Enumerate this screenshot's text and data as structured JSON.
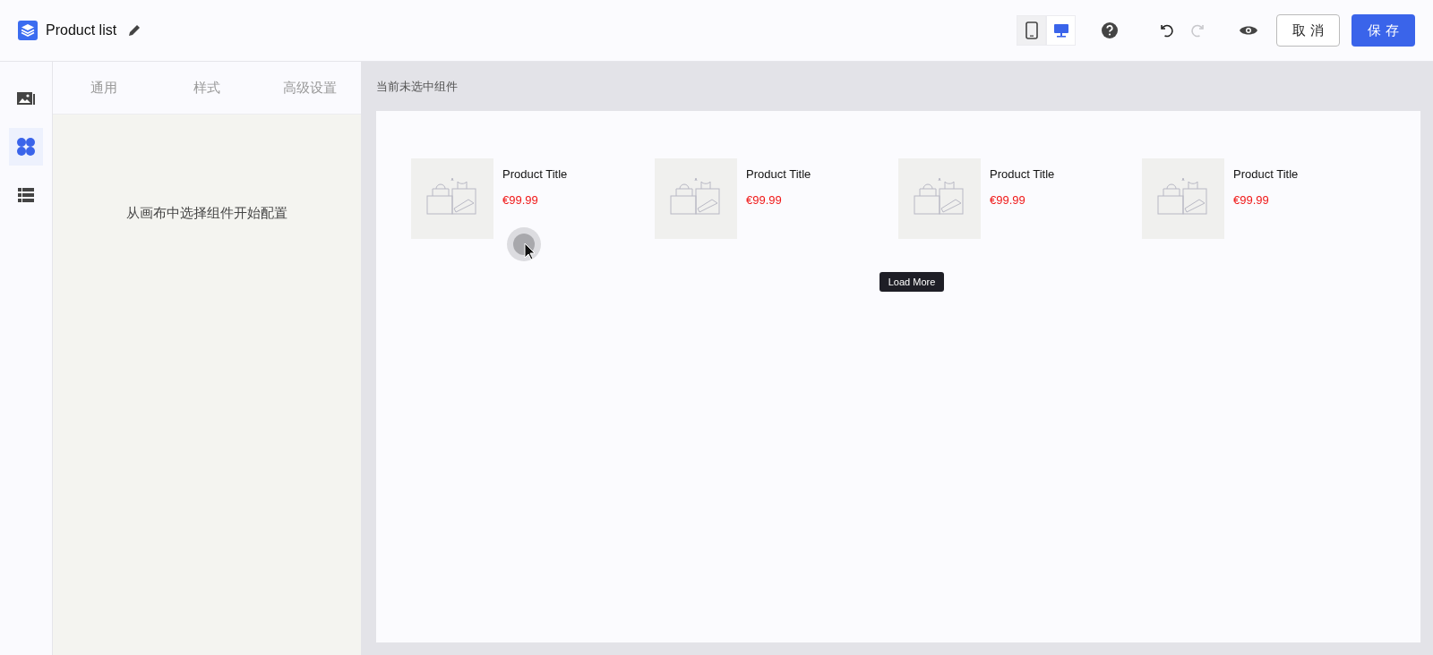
{
  "header": {
    "title": "Product list",
    "devices": [
      {
        "kind": "mobile",
        "selected": false
      },
      {
        "kind": "desktop",
        "selected": true
      }
    ],
    "history": [
      {
        "kind": "undo",
        "disabled": false
      },
      {
        "kind": "redo",
        "disabled": true
      }
    ],
    "cancel_label": "取 消",
    "save_label": "保 存"
  },
  "sidebar": {
    "items": [
      {
        "kind": "media",
        "selected": false
      },
      {
        "kind": "components",
        "selected": true
      },
      {
        "kind": "layout",
        "selected": false
      }
    ]
  },
  "panel": {
    "tabs": [
      {
        "label": "通用",
        "selected": false
      },
      {
        "label": "样式",
        "selected": false
      },
      {
        "label": "高级设置",
        "selected": false
      }
    ],
    "empty_hint": "从画布中选择组件开始配置"
  },
  "canvas": {
    "status": "当前未选中组件",
    "products": [
      {
        "title": "Product Title",
        "price": "€99.99"
      },
      {
        "title": "Product Title",
        "price": "€99.99"
      },
      {
        "title": "Product Title",
        "price": "€99.99"
      },
      {
        "title": "Product Title",
        "price": "€99.99"
      }
    ],
    "load_more": "Load More"
  }
}
